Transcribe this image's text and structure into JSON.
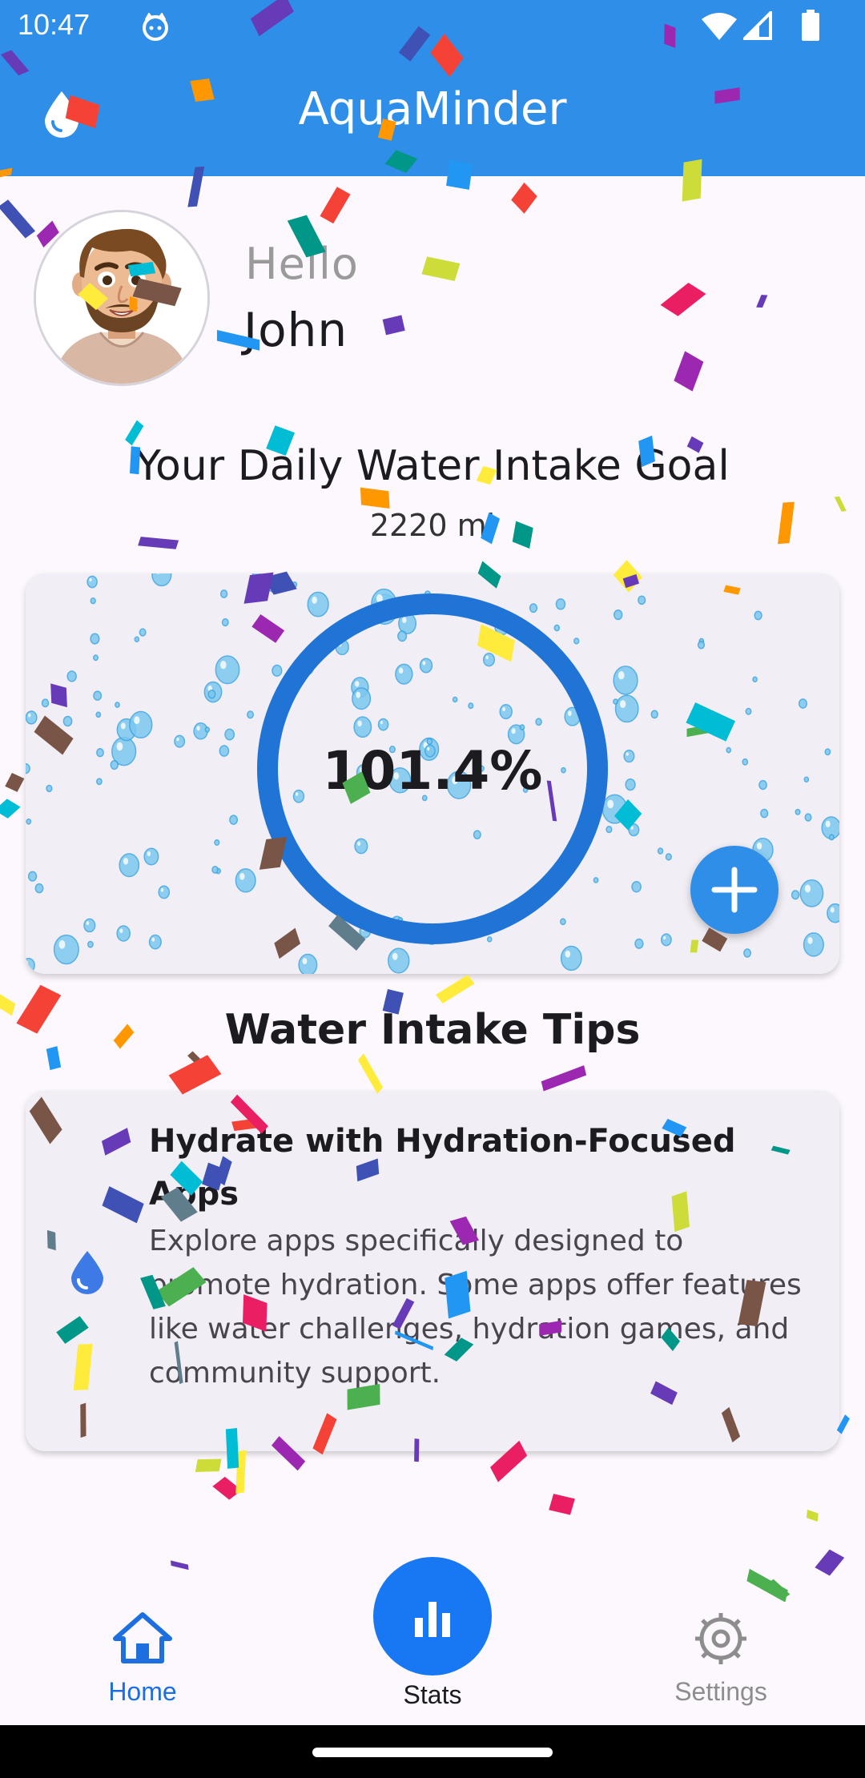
{
  "status_bar": {
    "time": "10:47"
  },
  "app_bar": {
    "title": "AquaMinder",
    "leading_icon": "water-drop-icon",
    "color": "#2f8ee8"
  },
  "greeting": {
    "hello": "Hello",
    "name": "John"
  },
  "goal": {
    "title": "Your Daily Water Intake Goal",
    "amount": "2220 ml"
  },
  "progress": {
    "percent_label": "101.4%",
    "fraction": 1.0,
    "ring_color": "#1f74d6",
    "add_button_icon": "plus-icon"
  },
  "tips": {
    "heading": "Water Intake Tips",
    "items": [
      {
        "icon": "water-drop-icon",
        "title": "Hydrate with Hydration-Focused Apps",
        "body": "Explore apps specifically designed to promote hydration. Some apps offer features like water challenges, hydration games, and community support."
      }
    ]
  },
  "bottom_nav": {
    "items": [
      {
        "label": "Home",
        "icon": "home-icon",
        "active": true
      },
      {
        "label": "Stats",
        "icon": "bar-chart-icon",
        "active": false
      },
      {
        "label": "Settings",
        "icon": "gear-icon",
        "active": false
      }
    ],
    "active_color": "#1d6fe0",
    "fab_color": "#1877f2"
  }
}
